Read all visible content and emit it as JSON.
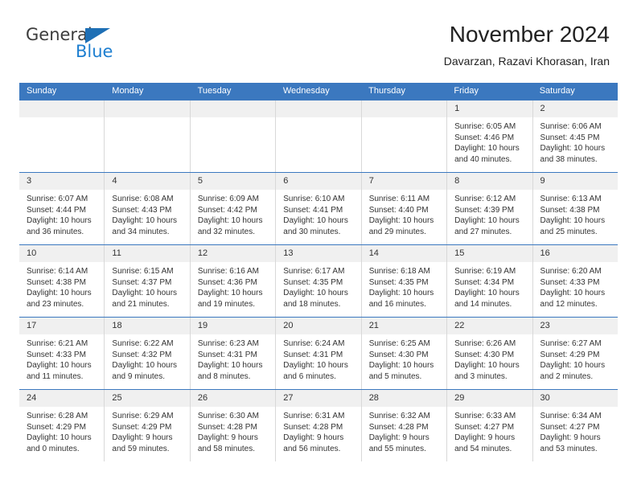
{
  "brand": {
    "name_part1": "General",
    "name_part2": "Blue",
    "triangle_color": "#1e6fb5",
    "blue_color": "#1e7fd0"
  },
  "header": {
    "title": "November 2024",
    "subtitle": "Davarzan, Razavi Khorasan, Iran",
    "accent_color": "#3b78bf"
  },
  "weekday_headers": [
    "Sunday",
    "Monday",
    "Tuesday",
    "Wednesday",
    "Thursday",
    "Friday",
    "Saturday"
  ],
  "weeks": [
    [
      {
        "day": "",
        "sunrise": "",
        "sunset": "",
        "daylight": ""
      },
      {
        "day": "",
        "sunrise": "",
        "sunset": "",
        "daylight": ""
      },
      {
        "day": "",
        "sunrise": "",
        "sunset": "",
        "daylight": ""
      },
      {
        "day": "",
        "sunrise": "",
        "sunset": "",
        "daylight": ""
      },
      {
        "day": "",
        "sunrise": "",
        "sunset": "",
        "daylight": ""
      },
      {
        "day": "1",
        "sunrise": "Sunrise: 6:05 AM",
        "sunset": "Sunset: 4:46 PM",
        "daylight": "Daylight: 10 hours and 40 minutes."
      },
      {
        "day": "2",
        "sunrise": "Sunrise: 6:06 AM",
        "sunset": "Sunset: 4:45 PM",
        "daylight": "Daylight: 10 hours and 38 minutes."
      }
    ],
    [
      {
        "day": "3",
        "sunrise": "Sunrise: 6:07 AM",
        "sunset": "Sunset: 4:44 PM",
        "daylight": "Daylight: 10 hours and 36 minutes."
      },
      {
        "day": "4",
        "sunrise": "Sunrise: 6:08 AM",
        "sunset": "Sunset: 4:43 PM",
        "daylight": "Daylight: 10 hours and 34 minutes."
      },
      {
        "day": "5",
        "sunrise": "Sunrise: 6:09 AM",
        "sunset": "Sunset: 4:42 PM",
        "daylight": "Daylight: 10 hours and 32 minutes."
      },
      {
        "day": "6",
        "sunrise": "Sunrise: 6:10 AM",
        "sunset": "Sunset: 4:41 PM",
        "daylight": "Daylight: 10 hours and 30 minutes."
      },
      {
        "day": "7",
        "sunrise": "Sunrise: 6:11 AM",
        "sunset": "Sunset: 4:40 PM",
        "daylight": "Daylight: 10 hours and 29 minutes."
      },
      {
        "day": "8",
        "sunrise": "Sunrise: 6:12 AM",
        "sunset": "Sunset: 4:39 PM",
        "daylight": "Daylight: 10 hours and 27 minutes."
      },
      {
        "day": "9",
        "sunrise": "Sunrise: 6:13 AM",
        "sunset": "Sunset: 4:38 PM",
        "daylight": "Daylight: 10 hours and 25 minutes."
      }
    ],
    [
      {
        "day": "10",
        "sunrise": "Sunrise: 6:14 AM",
        "sunset": "Sunset: 4:38 PM",
        "daylight": "Daylight: 10 hours and 23 minutes."
      },
      {
        "day": "11",
        "sunrise": "Sunrise: 6:15 AM",
        "sunset": "Sunset: 4:37 PM",
        "daylight": "Daylight: 10 hours and 21 minutes."
      },
      {
        "day": "12",
        "sunrise": "Sunrise: 6:16 AM",
        "sunset": "Sunset: 4:36 PM",
        "daylight": "Daylight: 10 hours and 19 minutes."
      },
      {
        "day": "13",
        "sunrise": "Sunrise: 6:17 AM",
        "sunset": "Sunset: 4:35 PM",
        "daylight": "Daylight: 10 hours and 18 minutes."
      },
      {
        "day": "14",
        "sunrise": "Sunrise: 6:18 AM",
        "sunset": "Sunset: 4:35 PM",
        "daylight": "Daylight: 10 hours and 16 minutes."
      },
      {
        "day": "15",
        "sunrise": "Sunrise: 6:19 AM",
        "sunset": "Sunset: 4:34 PM",
        "daylight": "Daylight: 10 hours and 14 minutes."
      },
      {
        "day": "16",
        "sunrise": "Sunrise: 6:20 AM",
        "sunset": "Sunset: 4:33 PM",
        "daylight": "Daylight: 10 hours and 12 minutes."
      }
    ],
    [
      {
        "day": "17",
        "sunrise": "Sunrise: 6:21 AM",
        "sunset": "Sunset: 4:33 PM",
        "daylight": "Daylight: 10 hours and 11 minutes."
      },
      {
        "day": "18",
        "sunrise": "Sunrise: 6:22 AM",
        "sunset": "Sunset: 4:32 PM",
        "daylight": "Daylight: 10 hours and 9 minutes."
      },
      {
        "day": "19",
        "sunrise": "Sunrise: 6:23 AM",
        "sunset": "Sunset: 4:31 PM",
        "daylight": "Daylight: 10 hours and 8 minutes."
      },
      {
        "day": "20",
        "sunrise": "Sunrise: 6:24 AM",
        "sunset": "Sunset: 4:31 PM",
        "daylight": "Daylight: 10 hours and 6 minutes."
      },
      {
        "day": "21",
        "sunrise": "Sunrise: 6:25 AM",
        "sunset": "Sunset: 4:30 PM",
        "daylight": "Daylight: 10 hours and 5 minutes."
      },
      {
        "day": "22",
        "sunrise": "Sunrise: 6:26 AM",
        "sunset": "Sunset: 4:30 PM",
        "daylight": "Daylight: 10 hours and 3 minutes."
      },
      {
        "day": "23",
        "sunrise": "Sunrise: 6:27 AM",
        "sunset": "Sunset: 4:29 PM",
        "daylight": "Daylight: 10 hours and 2 minutes."
      }
    ],
    [
      {
        "day": "24",
        "sunrise": "Sunrise: 6:28 AM",
        "sunset": "Sunset: 4:29 PM",
        "daylight": "Daylight: 10 hours and 0 minutes."
      },
      {
        "day": "25",
        "sunrise": "Sunrise: 6:29 AM",
        "sunset": "Sunset: 4:29 PM",
        "daylight": "Daylight: 9 hours and 59 minutes."
      },
      {
        "day": "26",
        "sunrise": "Sunrise: 6:30 AM",
        "sunset": "Sunset: 4:28 PM",
        "daylight": "Daylight: 9 hours and 58 minutes."
      },
      {
        "day": "27",
        "sunrise": "Sunrise: 6:31 AM",
        "sunset": "Sunset: 4:28 PM",
        "daylight": "Daylight: 9 hours and 56 minutes."
      },
      {
        "day": "28",
        "sunrise": "Sunrise: 6:32 AM",
        "sunset": "Sunset: 4:28 PM",
        "daylight": "Daylight: 9 hours and 55 minutes."
      },
      {
        "day": "29",
        "sunrise": "Sunrise: 6:33 AM",
        "sunset": "Sunset: 4:27 PM",
        "daylight": "Daylight: 9 hours and 54 minutes."
      },
      {
        "day": "30",
        "sunrise": "Sunrise: 6:34 AM",
        "sunset": "Sunset: 4:27 PM",
        "daylight": "Daylight: 9 hours and 53 minutes."
      }
    ]
  ]
}
